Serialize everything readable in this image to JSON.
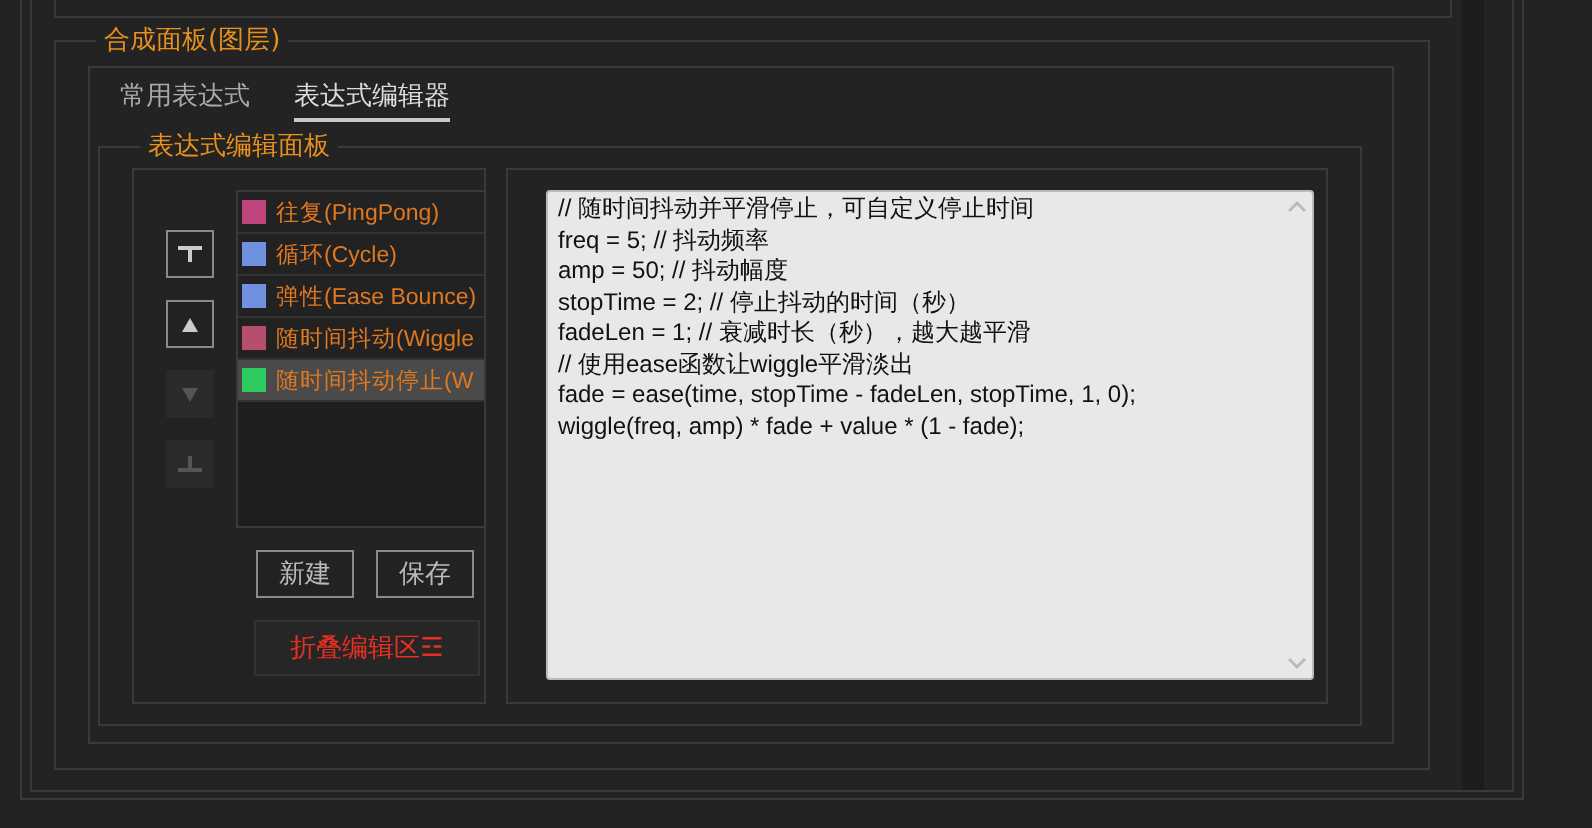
{
  "panel": {
    "title": "合成面板(图层)"
  },
  "tabs": [
    {
      "label": "常用表达式",
      "selected": false
    },
    {
      "label": "表达式编辑器",
      "selected": true
    }
  ],
  "editor_panel": {
    "title": "表达式编辑面板"
  },
  "move_buttons": [
    {
      "kind": "top",
      "disabled": false
    },
    {
      "kind": "up",
      "disabled": false
    },
    {
      "kind": "down",
      "disabled": true
    },
    {
      "kind": "bottom",
      "disabled": true
    }
  ],
  "expressions": [
    {
      "label": "往复(PingPong)",
      "color": "#c0457e",
      "selected": false
    },
    {
      "label": "循环(Cycle)",
      "color": "#7090e0",
      "selected": false
    },
    {
      "label": "弹性(Ease Bounce)",
      "color": "#7090e0",
      "selected": false
    },
    {
      "label": "随时间抖动(Wiggle",
      "color": "#b84e6e",
      "selected": false
    },
    {
      "label": "随时间抖动停止(W",
      "color": "#2ecc60",
      "selected": true
    }
  ],
  "buttons": [
    "新建",
    "保存"
  ],
  "collapse_button": "折叠编辑区☲",
  "code_lines": [
    "// 随时间抖动并平滑停止，可自定义停止时间",
    "freq = 5; // 抖动频率",
    "amp = 50; // 抖动幅度",
    "stopTime = 2; // 停止抖动的时间（秒）",
    "fadeLen = 1; // 衰减时长（秒），越大越平滑",
    "// 使用ease函数让wiggle平滑淡出",
    "fade = ease(time, stopTime - fadeLen, stopTime, 1, 0);",
    "wiggle(freq, amp) * fade + value * (1 - fade);"
  ]
}
